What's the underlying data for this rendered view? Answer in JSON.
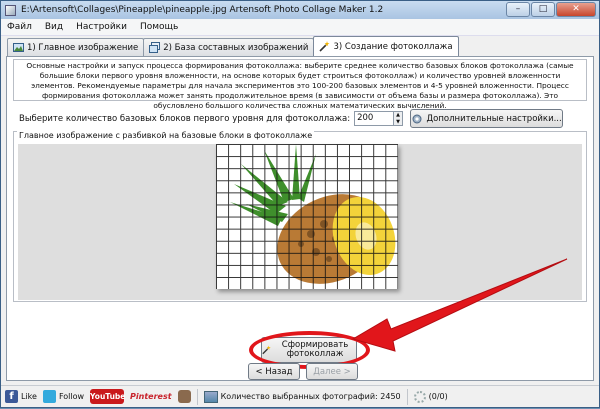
{
  "window": {
    "title": "E:\\Artensoft\\Collages\\Pineapple\\pineapple.jpg Artensoft Photo Collage Maker 1.2"
  },
  "menu": [
    "Файл",
    "Вид",
    "Настройки",
    "Помощь"
  ],
  "tabs": [
    {
      "label": "1) Главное изображение",
      "icon": "image-icon"
    },
    {
      "label": "2) База составных изображений",
      "icon": "images-icon"
    },
    {
      "label": "3) Создание фотоколлажа",
      "icon": "magic-wand-icon",
      "active": true
    }
  ],
  "description": "Основные настройки и запуск процесса формирования фотоколлажа: выберите среднее количество базовых блоков фотоколлажа (самые большие блоки первого уровня вложенности, на основе которых будет строиться фотоколлаж) и количество уровней вложенности элементов. Рекомендуемые параметры для начала экспериментов это 100-200 базовых элементов и 4-5 уровней вложенности. Процесс формирования фотоколлажа может занять продолжительное время (в зависимости от объема базы и размера фотоколлажа). Это обусловлено большого количества сложных математических вычислений.",
  "block_count": {
    "label": "Выберите количество базовых блоков первого уровня для фотоколлажа:",
    "value": "200"
  },
  "settings_button": "Дополнительные настройки...",
  "preview": {
    "title": "Главное изображение с разбивкой на базовые блоки в фотоколлаже"
  },
  "form_button": "Сформировать фотоколлаж",
  "nav": {
    "back": "< Назад",
    "next": "Далее >"
  },
  "status": {
    "like": "Like",
    "follow": "Follow",
    "youtube": "YouTube",
    "pinterest": "Pinterest",
    "selected_photos": "Количество выбранных фотографий: 2450",
    "progress": "(0/0)"
  },
  "colors": {
    "highlight": "#e1161b",
    "arrow": "#e1161b"
  }
}
